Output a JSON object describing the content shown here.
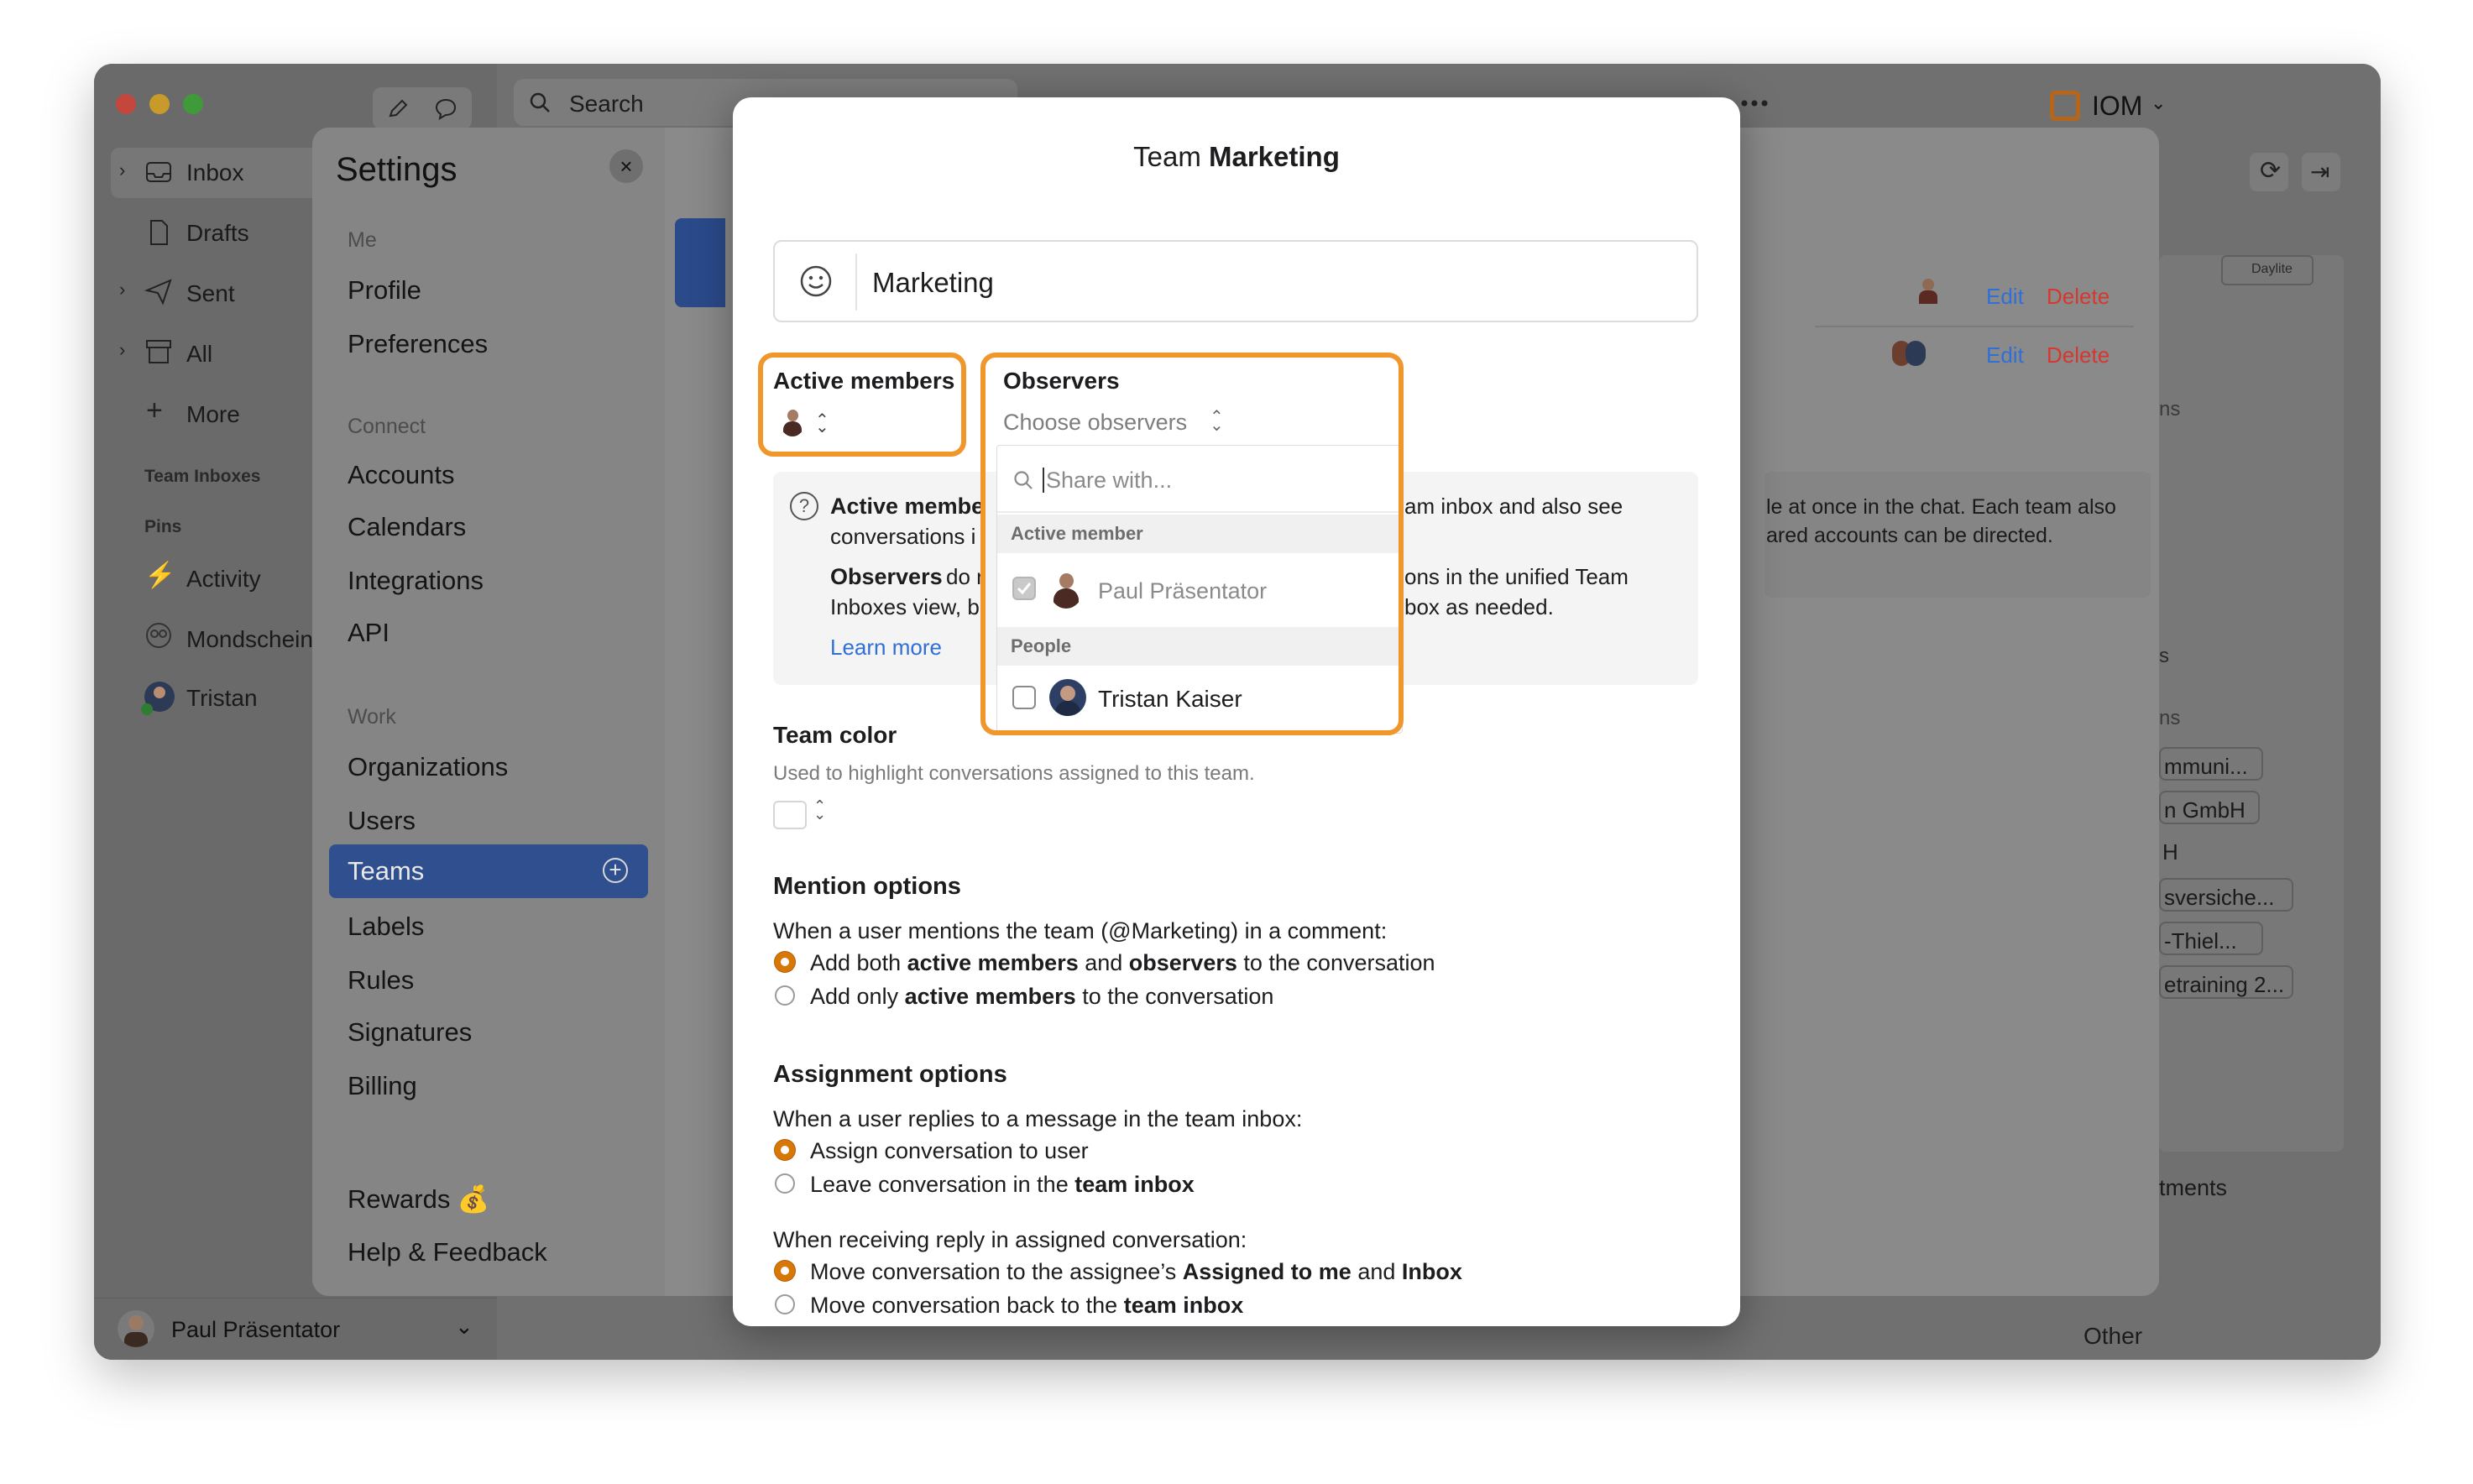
{
  "window": {
    "search_placeholder": "Search",
    "org_name": "IOM",
    "user_name": "Paul Präsentator",
    "other_label": "Other"
  },
  "sidebar": {
    "items": [
      {
        "label": "Inbox",
        "icon": "inbox-icon"
      },
      {
        "label": "Drafts",
        "icon": "drafts-icon"
      },
      {
        "label": "Sent",
        "icon": "sent-icon"
      },
      {
        "label": "All",
        "icon": "archive-icon"
      },
      {
        "label": "More",
        "icon": "plus-icon"
      }
    ],
    "team_inboxes_head": "Team Inboxes",
    "pins_head": "Pins",
    "pins": [
      {
        "label": "Activity",
        "icon": "bolt-icon"
      },
      {
        "label": "Mondschein",
        "icon": "team-icon"
      },
      {
        "label": "Tristan",
        "icon": "avatar-icon"
      }
    ]
  },
  "settings": {
    "title": "Settings",
    "groups": [
      {
        "head": "Me",
        "items": [
          "Profile",
          "Preferences"
        ]
      },
      {
        "head": "Connect",
        "items": [
          "Accounts",
          "Calendars",
          "Integrations",
          "API"
        ]
      },
      {
        "head": "Work",
        "items": [
          "Organizations",
          "Users",
          "Teams",
          "Labels",
          "Rules",
          "Signatures",
          "Billing"
        ]
      }
    ],
    "footer_items": [
      "Rewards 💰",
      "Help & Feedback"
    ],
    "selected": "Teams"
  },
  "background_rows": {
    "edit_label": "Edit",
    "delete_label": "Delete",
    "partial_texts": [
      "le at once in the chat. Each team also",
      "ared accounts can be directed."
    ],
    "right_tags": [
      "mmuni...",
      "n GmbH",
      "H",
      "sversiche...",
      "-Thiel...",
      "etraining 2..."
    ],
    "tag_daylite": "Daylite",
    "partial_ments": "tments",
    "partial_s1": "ns",
    "partial_s2": "s",
    "partial_s3": "ns"
  },
  "dialog": {
    "title_prefix": "Team",
    "title_name": "Marketing",
    "name_value": "Marketing",
    "active_members_label": "Active members",
    "observers_label": "Observers",
    "observers_placeholder": "Choose observers",
    "info": {
      "active_bold": "Active membe",
      "active_rest_right": "am inbox and also see",
      "line2_left": "conversations i",
      "observers_bold": "Observers",
      "observers_rest": "do r",
      "obs_rest_right": "ons in the unified Team",
      "line4_left": "Inboxes view, b",
      "line4_right": "box as needed.",
      "learn_more": "Learn more"
    },
    "team_color_label": "Team color",
    "team_color_help": "Used to highlight conversations assigned to this team.",
    "mention": {
      "title": "Mention options",
      "prompt": "When a user mentions the team (@Marketing) in a comment:",
      "opt1_pre": "Add both ",
      "opt1_b1": "active members",
      "opt1_mid": " and ",
      "opt1_b2": "observers",
      "opt1_post": " to the conversation",
      "opt2_pre": "Add only ",
      "opt2_b1": "active members",
      "opt2_post": " to the conversation"
    },
    "assignment": {
      "title": "Assignment options",
      "prompt1": "When a user replies to a message in the team inbox:",
      "a1": "Assign conversation to user",
      "a2_pre": "Leave conversation in the ",
      "a2_b": "team inbox",
      "prompt2": "When receiving reply in assigned conversation:",
      "b1_pre": "Move conversation to the assignee’s ",
      "b1_b1": "Assigned to me",
      "b1_mid": " and ",
      "b1_b2": "Inbox",
      "b2_pre": "Move conversation back to the ",
      "b2_b": "team inbox"
    }
  },
  "dropdown": {
    "search_placeholder": "Share with...",
    "head_active": "Active member",
    "active_person": "Paul Präsentator",
    "head_people": "People",
    "people_person": "Tristan Kaiser"
  },
  "colors": {
    "accent_orange": "#f0962a",
    "selected_blue": "#2f5fd0",
    "link_blue": "#2f6fd6",
    "delete_red": "#d6372e"
  }
}
